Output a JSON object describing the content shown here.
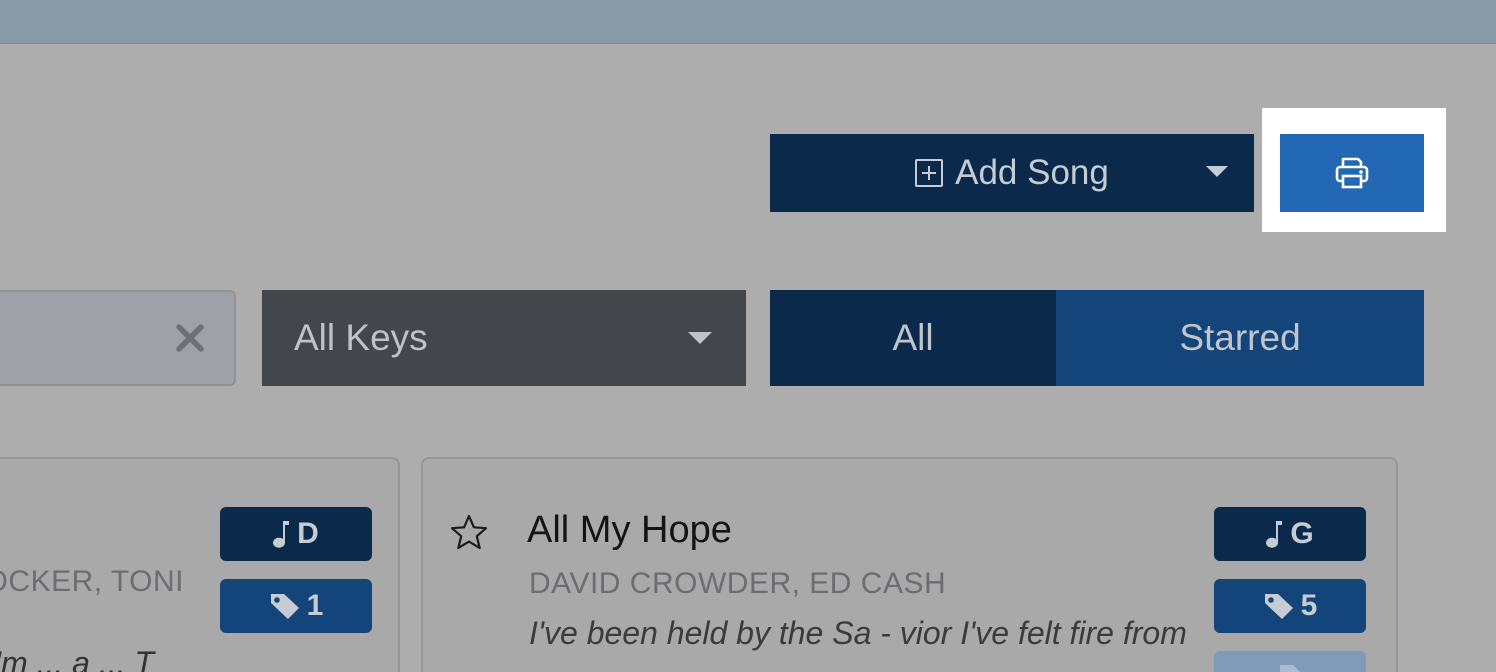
{
  "toolbar": {
    "add_song_label": "Add Song"
  },
  "filters": {
    "search_value": "",
    "keys_select": "All Keys",
    "segment_all": "All",
    "segment_starred": "Starred"
  },
  "cards": [
    {
      "key": "D",
      "tag_count": "1",
      "authors_partial": "OCKER, TONI",
      "lyric_partial": "I'm ... a ... T"
    },
    {
      "title": "All My Hope",
      "authors": "DAVID CROWDER, ED CASH",
      "lyric": "I've been held by the Sa - vior I've felt fire from",
      "key": "G",
      "tag_count": "5"
    }
  ],
  "colors": {
    "navy": "#0b2a4b",
    "blue": "#14457a",
    "print_blue": "#2368b4",
    "dark_select": "#43474c"
  }
}
